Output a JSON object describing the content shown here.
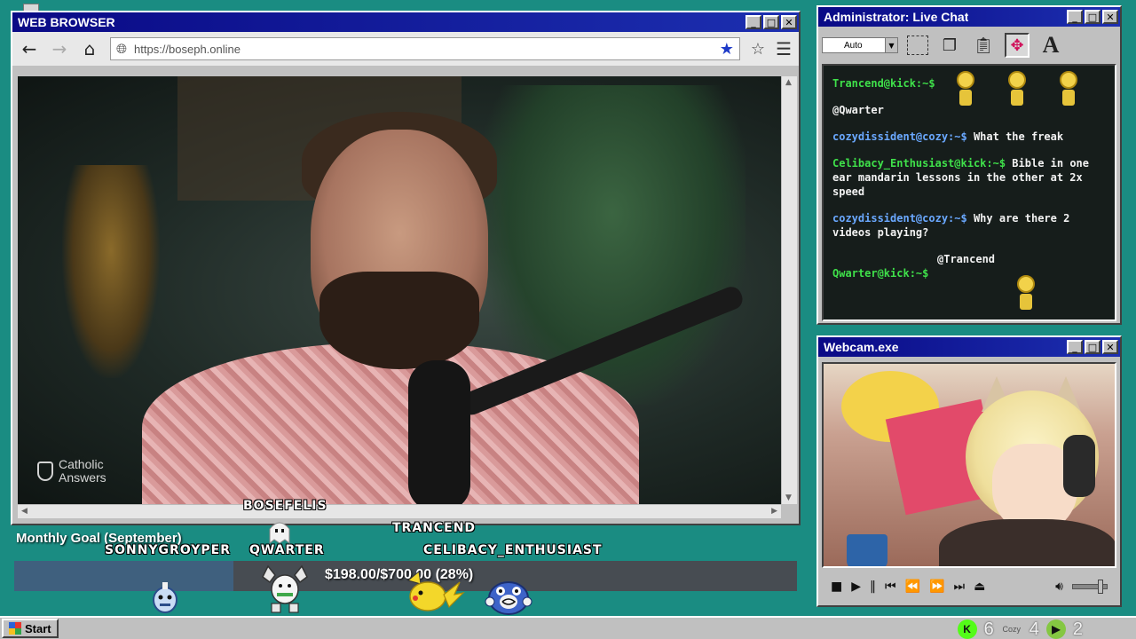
{
  "browser": {
    "title": "WEB BROWSER",
    "url": "https://boseph.online",
    "video": {
      "watermark_line1": "Catholic",
      "watermark_line2": "Answers"
    }
  },
  "window_buttons": {
    "minimize": "_",
    "maximize": "□",
    "close": "✕"
  },
  "chat": {
    "title": "Administrator: Live Chat",
    "font_select": "Auto",
    "messages": [
      {
        "user": "Trancend@kick:~$",
        "text": "",
        "user_color": "green"
      },
      {
        "user": "",
        "text": "@Qwarter",
        "user_color": "none"
      },
      {
        "user": "cozydissident@cozy:~$",
        "text": " What the freak",
        "user_color": "blue"
      },
      {
        "user": "Celibacy_Enthusiast@kick:~$",
        "text": " Bible in one ear mandarin lessons in the other at 2x speed",
        "user_color": "green"
      },
      {
        "user": "cozydissident@cozy:~$",
        "text": " Why are there 2 videos playing?",
        "user_color": "blue"
      }
    ],
    "last_mention": "@Trancend",
    "last_user": "Qwarter@kick:~$"
  },
  "webcam": {
    "title": "Webcam.exe"
  },
  "goal": {
    "title": "Monthly Goal (September)",
    "text": "$198.00/$700.00 (28%)",
    "progress": 0.28
  },
  "sprites": [
    {
      "name": "BOSEFELIS"
    },
    {
      "name": "TRANCEND"
    },
    {
      "name": "SONNYGROYPER"
    },
    {
      "name": "QWARTER"
    },
    {
      "name": "CELIBACY_ENTHUSIAST"
    }
  ],
  "taskbar": {
    "start_label": "Start",
    "kick_count": "6",
    "cozy_label": "Cozy",
    "cozy_count": "4",
    "rumble_count": "2"
  },
  "colors": {
    "desktop": "#1a8c82",
    "titlebar": "#0a0a86",
    "chat_green": "#3fe04a",
    "chat_blue": "#6aa8ff",
    "goal_fill": "#3f607e",
    "kick_green": "#53fc18",
    "rumble_green": "#85c742"
  },
  "icons": {
    "back": "arrow-left-icon",
    "forward": "arrow-right-icon",
    "home": "home-icon",
    "globe": "globe-icon",
    "bookmark_filled": "star-filled-icon",
    "bookmark": "star-outline-icon",
    "menu": "hamburger-menu-icon"
  }
}
